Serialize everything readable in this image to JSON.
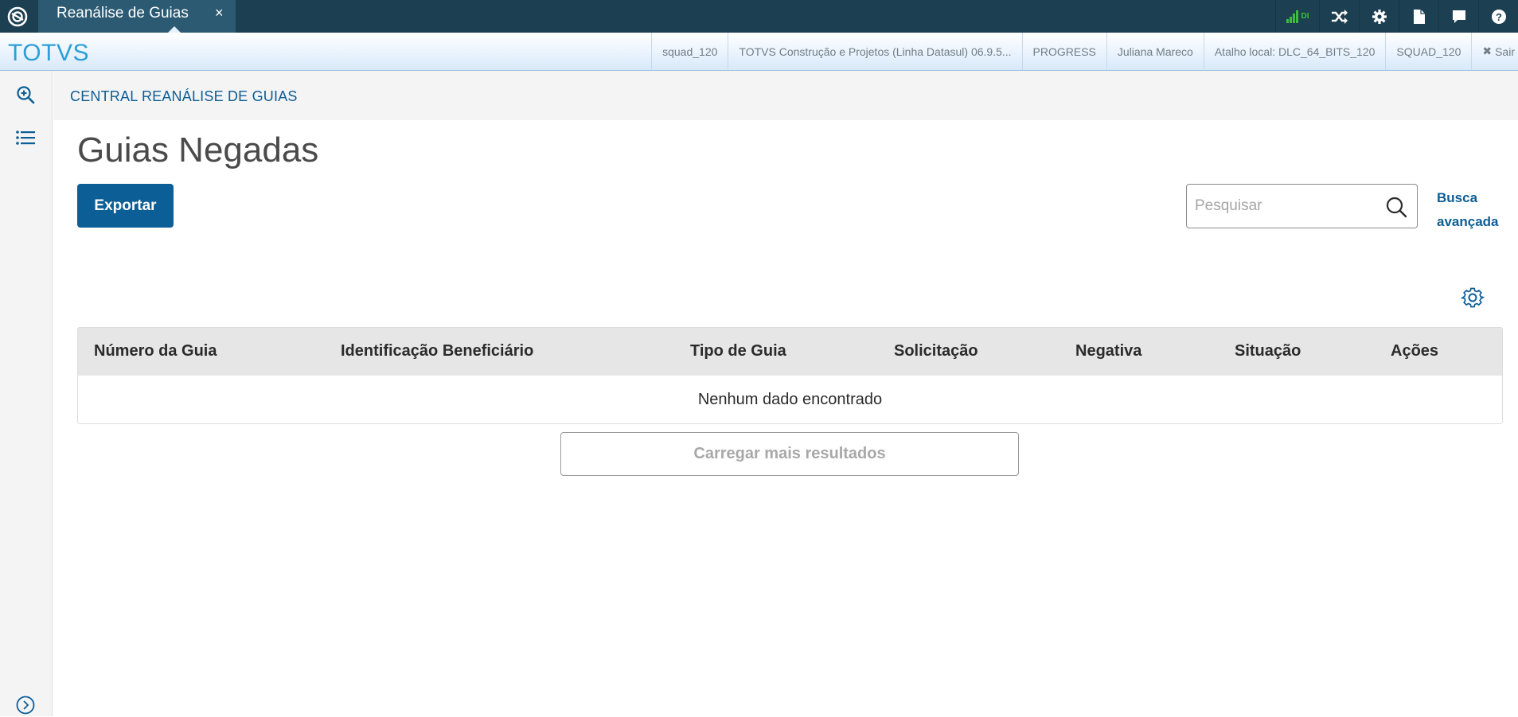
{
  "topbar": {
    "tab_label": "Reanálise de Guias",
    "tab_close": "×",
    "signal_text": "DI",
    "icons": [
      "logo-icon",
      "signal-icon",
      "shuffle-icon",
      "gear-icon",
      "document-icon",
      "chat-icon",
      "help-icon"
    ]
  },
  "subbar": {
    "brand": "TOTVS",
    "env": [
      "squad_120",
      "TOTVS Construção e Projetos (Linha Datasul) 06.9.5...",
      "PROGRESS",
      "Juliana Mareco",
      "Atalho local: DLC_64_BITS_120",
      "SQUAD_120"
    ],
    "logout_label": "Sair"
  },
  "sidebar": {
    "icons": [
      "zoom-in-icon",
      "list-icon",
      "expand-chevron-icon"
    ]
  },
  "breadcrumb": "CENTRAL REANÁLISE DE GUIAS",
  "page_title": "Guias Negadas",
  "actions": {
    "export_label": "Exportar"
  },
  "search": {
    "placeholder": "Pesquisar",
    "value": "",
    "advanced_label_line1": "Busca",
    "advanced_label_line2": "avançada"
  },
  "table": {
    "columns": [
      "Número da Guia",
      "Identificação Beneficiário",
      "Tipo de Guia",
      "Solicitação",
      "Negativa",
      "Situação",
      "Ações"
    ],
    "rows": [],
    "empty_message": "Nenhum dado encontrado"
  },
  "load_more_label": "Carregar mais resultados",
  "colors": {
    "topbar_bg": "#1d3f52",
    "tab_bg": "#2c5a72",
    "primary": "#0c5e96",
    "brand": "#2a9fd8",
    "signal": "#3bbf3b"
  }
}
